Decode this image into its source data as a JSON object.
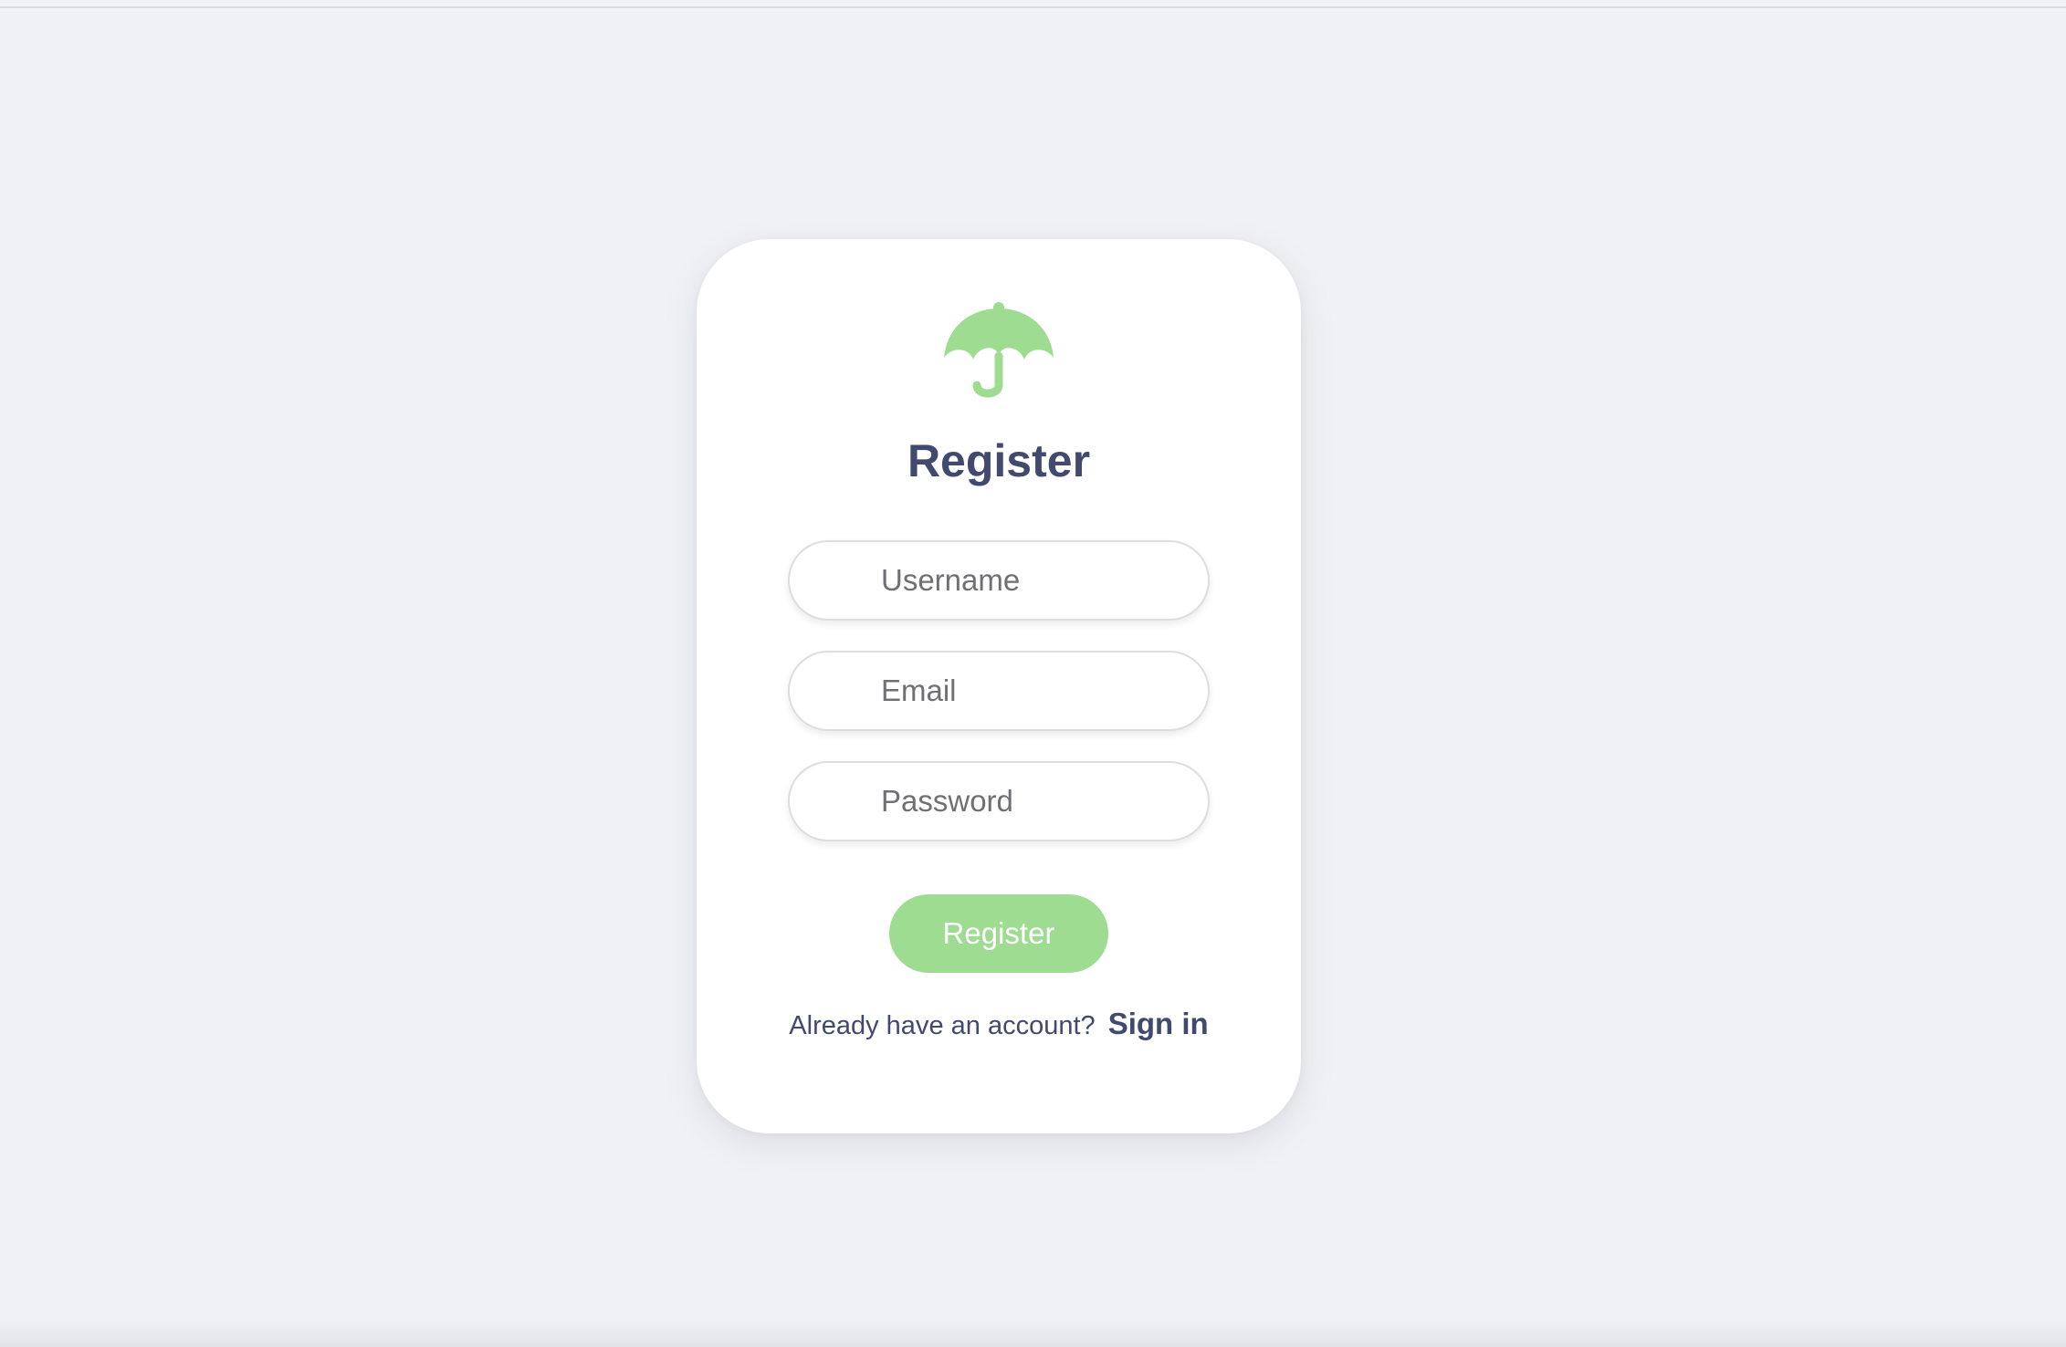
{
  "page": {
    "background_color": "#f0f1f5"
  },
  "brand": {
    "logo_icon": "umbrella-icon",
    "accent_color": "#9edc92"
  },
  "form": {
    "title": "Register",
    "username": {
      "placeholder": "Username",
      "value": ""
    },
    "email": {
      "placeholder": "Email",
      "value": ""
    },
    "password": {
      "placeholder": "Password",
      "value": ""
    },
    "submit_label": "Register"
  },
  "footer": {
    "prompt": "Already have an account?",
    "signin_label": "Sign in"
  }
}
